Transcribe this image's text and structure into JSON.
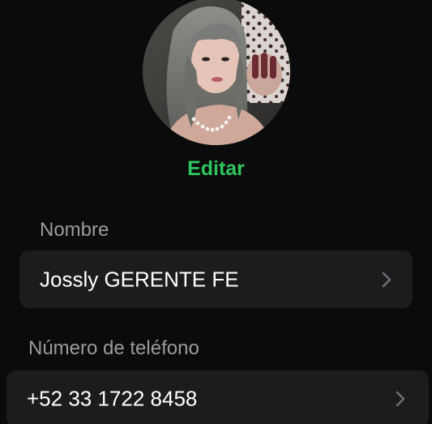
{
  "profile": {
    "avatar_icon": "profile-photo",
    "edit_label": "Editar",
    "accent_color": "#2ec55f"
  },
  "name_section": {
    "label": "Nombre",
    "value": "Jossly GERENTE FE",
    "chevron_icon": "chevron-right-icon"
  },
  "phone_section": {
    "label": "Número de teléfono",
    "value": "+52 33 1722 8458",
    "chevron_icon": "chevron-right-icon"
  }
}
